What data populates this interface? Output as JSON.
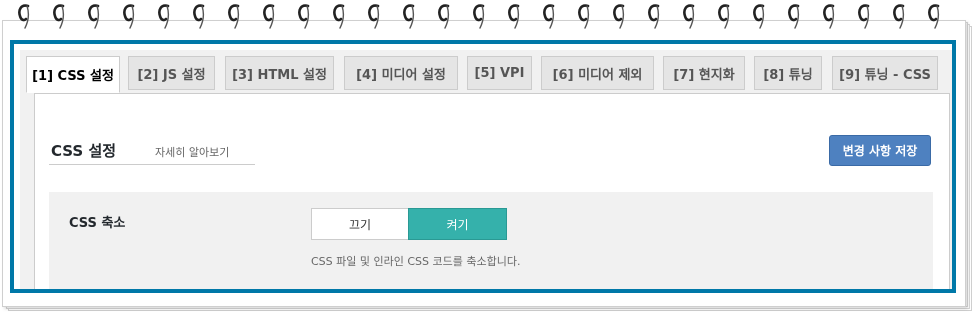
{
  "tabs": [
    {
      "label": "[1] CSS 설정",
      "active": true
    },
    {
      "label": "[2] JS 설정",
      "active": false
    },
    {
      "label": "[3] HTML 설정",
      "active": false
    },
    {
      "label": "[4] 미디어 설정",
      "active": false
    },
    {
      "label": "[5] VPI",
      "active": false
    },
    {
      "label": "[6] 미디어 제외",
      "active": false
    },
    {
      "label": "[7] 현지화",
      "active": false
    },
    {
      "label": "[8] 튜닝",
      "active": false
    },
    {
      "label": "[9] 튜닝 - CSS",
      "active": false
    }
  ],
  "section": {
    "title": "CSS 설정",
    "learn_more": "자세히 알아보기",
    "save_label": "변경 사항 저장"
  },
  "setting": {
    "label": "CSS 축소",
    "toggle_off": "끄기",
    "toggle_on": "켜기",
    "toggle_state": "on",
    "description": "CSS 파일 및 인라인 CSS 코드를 축소합니다."
  },
  "colors": {
    "frame": "#0078a8",
    "save_button": "#4e81c0",
    "toggle_on": "#35b1ab"
  },
  "decoration": {
    "spiral_ring_icon": "spiral-ring-icon"
  }
}
